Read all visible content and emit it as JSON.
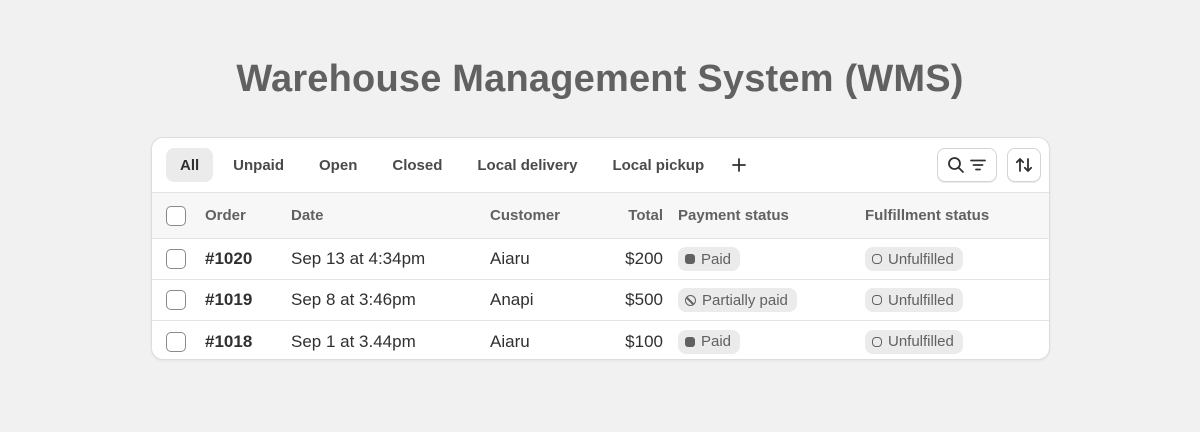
{
  "page": {
    "title": "Warehouse Management System (WMS)"
  },
  "tabs": [
    {
      "label": "All",
      "active": true
    },
    {
      "label": "Unpaid",
      "active": false
    },
    {
      "label": "Open",
      "active": false
    },
    {
      "label": "Closed",
      "active": false
    },
    {
      "label": "Local delivery",
      "active": false
    },
    {
      "label": "Local pickup",
      "active": false
    }
  ],
  "toolbar": {
    "add_icon": "plus-icon",
    "search_icon": "search-icon",
    "filter_icon": "filter-lines-icon",
    "sort_icon": "sort-arrows-icon"
  },
  "table": {
    "columns": {
      "order": "Order",
      "date": "Date",
      "customer": "Customer",
      "total": "Total",
      "payment": "Payment status",
      "fulfillment": "Fulfillment status"
    },
    "rows": [
      {
        "order": "#1020",
        "date": "Sep 13 at 4:34pm",
        "customer": "Aiaru",
        "total": "$200",
        "payment": "Paid",
        "payment_icon": "filled-dot-icon",
        "fulfillment": "Unfulfilled",
        "fulfillment_icon": "ring-icon"
      },
      {
        "order": "#1019",
        "date": "Sep 8 at 3:46pm",
        "customer": "Anapi",
        "total": "$500",
        "payment": "Partially paid",
        "payment_icon": "partial-circle-icon",
        "fulfillment": "Unfulfilled",
        "fulfillment_icon": "ring-icon"
      },
      {
        "order": "#1018",
        "date": "Sep 1 at 3.44pm",
        "customer": "Aiaru",
        "total": "$100",
        "payment": "Paid",
        "payment_icon": "filled-dot-icon",
        "fulfillment": "Unfulfilled",
        "fulfillment_icon": "ring-icon"
      }
    ]
  },
  "colors": {
    "background": "#f1f1f1",
    "card": "#ffffff",
    "title": "#616161",
    "badge": "#ebebeb",
    "active_tab": "#ebebeb"
  }
}
